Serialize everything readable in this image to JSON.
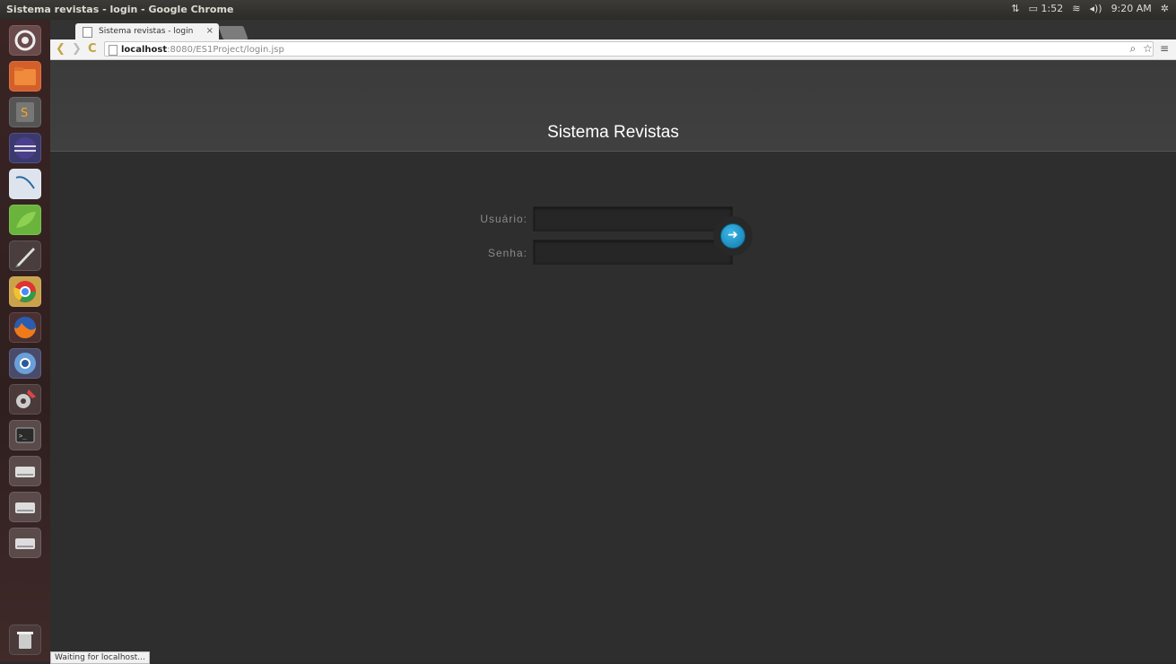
{
  "window": {
    "title": "Sistema revistas - login - Google Chrome"
  },
  "indicators": {
    "battery": "1:52",
    "clock": "9:20 AM"
  },
  "tabs": [
    {
      "label": "Sistema revistas - login",
      "close": "×"
    }
  ],
  "omnibox": {
    "host": "localhost",
    "path": ":8080/ES1Project/login.jsp"
  },
  "page": {
    "title": "Sistema Revistas",
    "username_label": "Usuário:",
    "password_label": "Senha:",
    "username_value": "",
    "password_value": ""
  },
  "status": {
    "text": "Waiting for localhost..."
  },
  "launcher_icons": [
    "ubuntu-dash-icon",
    "files-icon",
    "sublime-text-icon",
    "eclipse-icon",
    "mysql-workbench-icon",
    "spring-tool-icon",
    "inkscape-icon",
    "chrome-icon",
    "firefox-icon",
    "chromium-icon",
    "system-settings-icon",
    "terminal-icon",
    "drive-icon",
    "drive-icon",
    "drive-icon",
    "trash-icon"
  ],
  "colors": {
    "accent": "#1f9ad6",
    "page_bg": "#2e2e2e"
  }
}
